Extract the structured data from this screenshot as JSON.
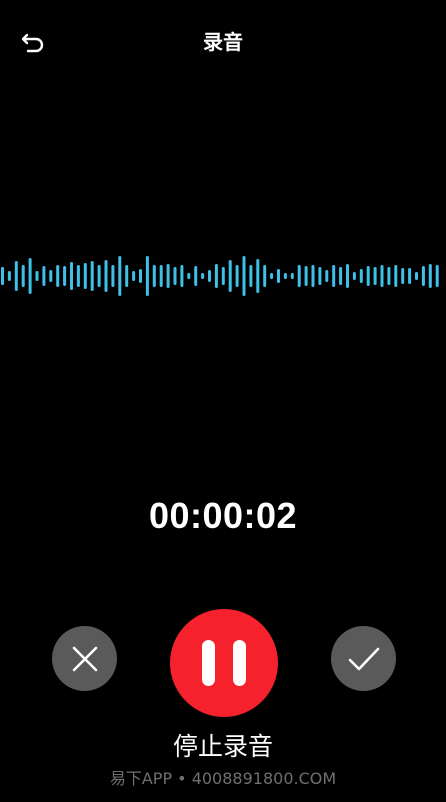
{
  "header": {
    "title": "录音",
    "back_icon": "back-arrow-icon"
  },
  "waveform": {
    "color": "#3ec1e8",
    "levels": [
      0.45,
      0.25,
      0.75,
      0.55,
      0.9,
      0.25,
      0.5,
      0.3,
      0.55,
      0.5,
      0.7,
      0.55,
      0.65,
      0.75,
      0.55,
      0.8,
      0.55,
      1.0,
      0.55,
      0.25,
      0.35,
      1.0,
      0.55,
      0.55,
      0.6,
      0.45,
      0.55,
      0.15,
      0.5,
      0.15,
      0.3,
      0.6,
      0.45,
      0.8,
      0.55,
      1.0,
      0.55,
      0.85,
      0.55,
      0.15,
      0.35,
      0.15,
      0.15,
      0.55,
      0.5,
      0.55,
      0.45,
      0.3,
      0.55,
      0.45,
      0.6,
      0.2,
      0.35,
      0.5,
      0.45,
      0.55,
      0.45,
      0.55,
      0.4,
      0.4,
      0.2,
      0.5,
      0.6,
      0.55
    ]
  },
  "timer": {
    "elapsed": "00:00:02"
  },
  "controls": {
    "cancel_icon": "close-icon",
    "pause_icon": "pause-icon",
    "confirm_icon": "check-icon",
    "pause_color": "#f5222d",
    "side_button_color": "#5a5a5a",
    "stop_label": "停止录音"
  },
  "watermark": {
    "text": "易下APP • 4008891800.COM"
  }
}
